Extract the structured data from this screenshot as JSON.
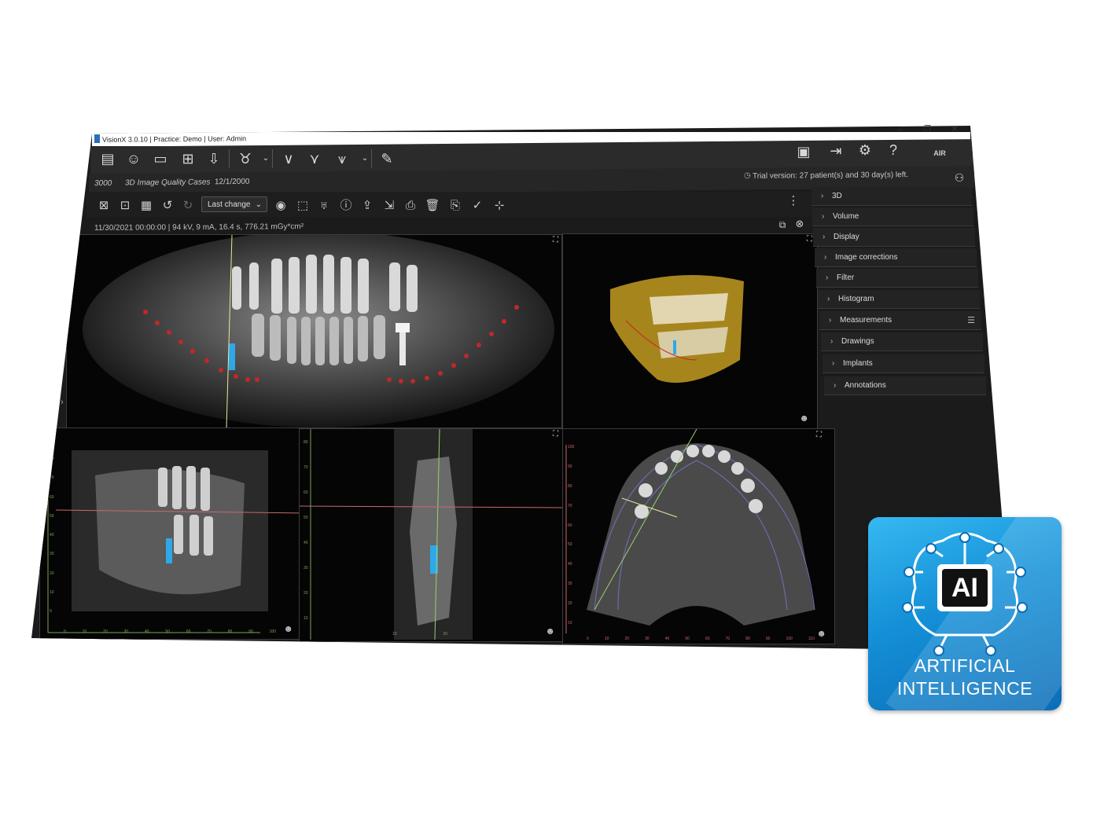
{
  "window": {
    "title": "VisionX 3.0.10 | Practice: Demo | User: Admin",
    "controls": [
      "–",
      "❐",
      "✕"
    ]
  },
  "toolbar": {
    "icons": [
      "patient-list-icon",
      "patients-icon",
      "patient-card-icon",
      "clipboard-add-icon",
      "import-icon",
      "tooth-icon",
      "arch-icon",
      "arch-curve-icon",
      "nerve-icon",
      "pen-icon"
    ],
    "right_icons": [
      "image-report-icon",
      "export-icon",
      "settings-icon",
      "help-icon"
    ],
    "brand": "AIR TECHNIQUES"
  },
  "infobar": {
    "patient_id": "3000",
    "study": "3D Image Quality Cases",
    "date": "12/1/2000",
    "trial": "Trial version: 27 patient(s) and 30 day(s) left."
  },
  "image_toolbar": {
    "dropdown": "Last change",
    "meta": "11/30/2021 00:00:00 | 94 kV, 9 mA, 16.4 s, 776.21 mGy*cm²"
  },
  "panel": {
    "items": [
      "3D",
      "Volume",
      "Display",
      "Image corrections",
      "Filter",
      "Histogram",
      "Measurements",
      "Drawings",
      "Implants",
      "Annotations"
    ]
  },
  "viewports": {
    "sagittal_x_ticks": [
      "0",
      "10",
      "20",
      "30",
      "40",
      "50",
      "60",
      "70",
      "80",
      "90",
      "100"
    ],
    "sagittal_y_ticks": [
      "80",
      "70",
      "60",
      "50",
      "40",
      "30",
      "20",
      "10",
      "0"
    ],
    "cross_y_ticks": [
      "80",
      "70",
      "60",
      "50",
      "40",
      "30",
      "20",
      "10"
    ],
    "cross_x_ticks": [
      "10",
      "20"
    ],
    "axial_x_ticks": [
      "0",
      "10",
      "20",
      "30",
      "40",
      "50",
      "60",
      "70",
      "80",
      "90",
      "100",
      "110"
    ],
    "axial_y_ticks": [
      "100",
      "90",
      "80",
      "70",
      "60",
      "50",
      "40",
      "30",
      "20",
      "10"
    ]
  },
  "badge": {
    "chip": "AI",
    "line1": "ARTIFICIAL",
    "line2": "INTELLIGENCE"
  },
  "colors": {
    "accent_blue": "#1a96dc",
    "panoramic_curve": "#c0282a",
    "implant": "#2fa8e8",
    "volume_render": "#b99320"
  }
}
